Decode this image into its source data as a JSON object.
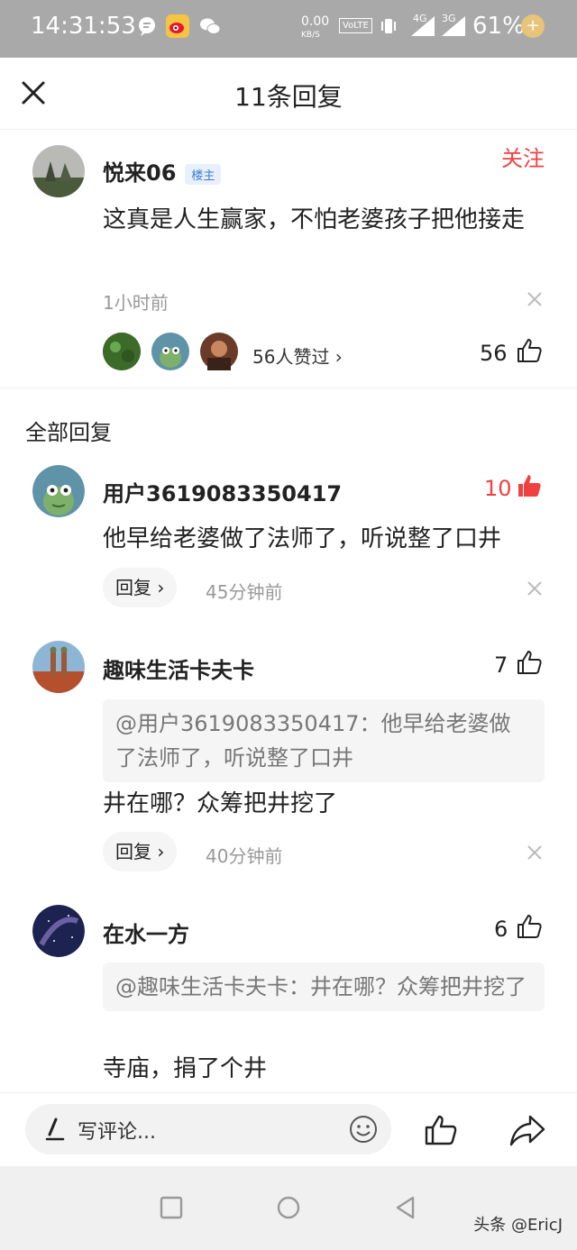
{
  "status": {
    "time": "14:31:53",
    "net_speed": "0.00",
    "net_unit": "KB/S",
    "volte": "VoLTE",
    "sig1": "4G",
    "sig2": "3G",
    "battery": "61%",
    "icons": [
      "chat-bubble-icon",
      "weibo-icon",
      "wechat-icon",
      "vibrate-icon",
      "signal-icon",
      "charging-icon"
    ]
  },
  "header": {
    "title": "11条回复",
    "close_icon": "close-icon"
  },
  "main_comment": {
    "name": "悦来06",
    "tag": "楼主",
    "follow": "关注",
    "text": "这真是人生赢家，不怕老婆孩子把他接走",
    "time": "1小时前",
    "liked_by": "56人赞过 ›",
    "likes": "56"
  },
  "section_title": "全部回复",
  "replies": [
    {
      "name": "用户3619083350417",
      "likes": "10",
      "text": "他早给老婆做了法师了，听说整了口井",
      "reply_label": "回复 ›",
      "time": "45分钟前"
    },
    {
      "name": "趣味生活卡夫卡",
      "likes": "7",
      "quote": "@用户3619083350417：他早给老婆做了法师了，听说整了口井",
      "text": "井在哪？众筹把井挖了",
      "reply_label": "回复 ›",
      "time": "40分钟前"
    },
    {
      "name": "在水一方",
      "likes": "6",
      "quote": "@趣味生活卡夫卡：井在哪？众筹把井挖了",
      "text": "寺庙，捐了个井"
    }
  ],
  "bottom": {
    "placeholder": "写评论..."
  },
  "watermark": "头条 @EricJ",
  "colors": {
    "accent_red": "#f04142",
    "tag_blue": "#3a7bd5",
    "status_bar": "#a9a9a9"
  }
}
